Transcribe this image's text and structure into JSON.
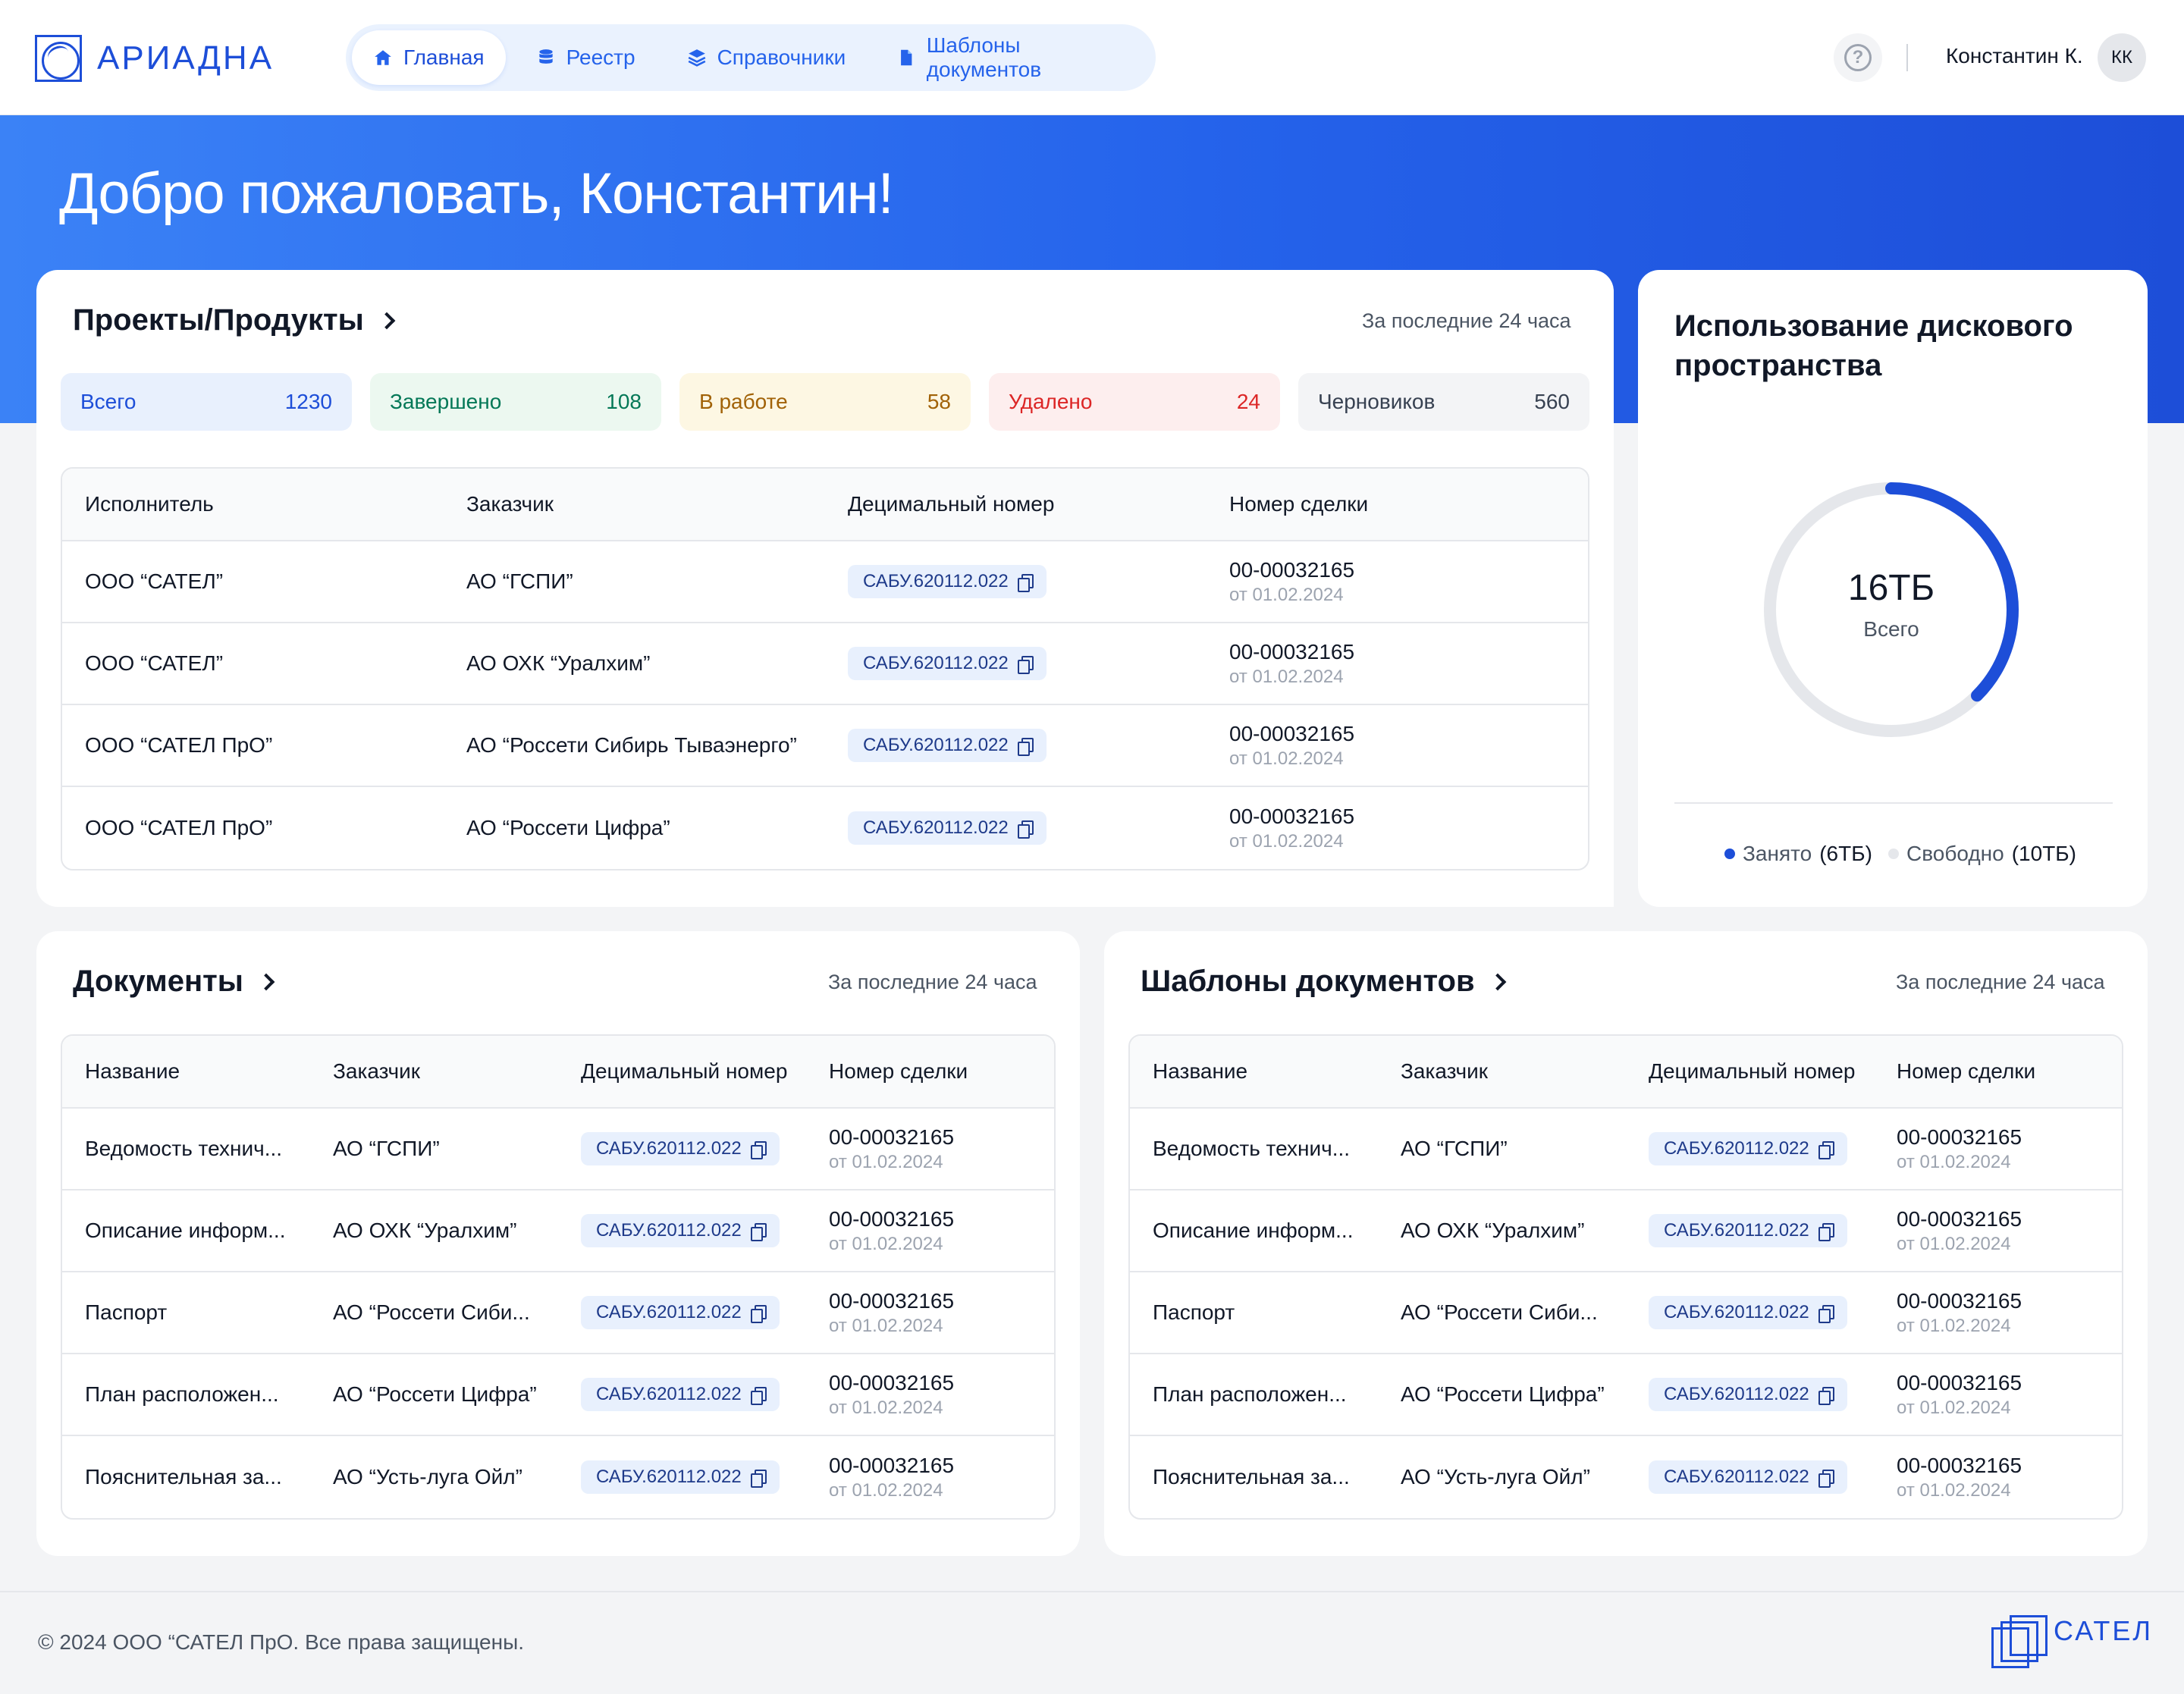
{
  "app": {
    "logo_text": "АРИАДНА"
  },
  "nav": {
    "items": [
      {
        "label": "Главная",
        "icon": "home-icon",
        "active": true
      },
      {
        "label": "Реестр",
        "icon": "database-icon",
        "active": false
      },
      {
        "label": "Справочники",
        "icon": "layers-icon",
        "active": false
      },
      {
        "label": "Шаблоны документов",
        "icon": "document-icon",
        "active": false
      }
    ]
  },
  "header": {
    "user_name": "Константин К.",
    "avatar_initials": "КК",
    "help_icon": "help-icon"
  },
  "hero": {
    "title": "Добро пожаловать, Константин!"
  },
  "projects": {
    "title": "Проекты/Продукты",
    "period": "За последние 24 часа",
    "stats": [
      {
        "label": "Всего",
        "value": "1230",
        "bg": "#e8f0fd",
        "fg": "#1d4ed8"
      },
      {
        "label": "Завершено",
        "value": "108",
        "bg": "#ecf8f0",
        "fg": "#047857"
      },
      {
        "label": "В работе",
        "value": "58",
        "bg": "#fdf7e3",
        "fg": "#a16207"
      },
      {
        "label": "Удалено",
        "value": "24",
        "bg": "#fdeeee",
        "fg": "#dc2626"
      },
      {
        "label": "Черновиков",
        "value": "560",
        "bg": "#f3f4f6",
        "fg": "#374151"
      }
    ],
    "columns": [
      "Исполнитель",
      "Заказчик",
      "Децимальный номер",
      "Номер сделки"
    ],
    "rows": [
      {
        "executor": "ООО “САТЕЛ”",
        "customer": "АО “ГСПИ”",
        "decimal": "САБУ.620112.022",
        "deal": "00-00032165",
        "deal_date": "от 01.02.2024"
      },
      {
        "executor": "ООО “САТЕЛ”",
        "customer": "АО ОХК “Уралхим”",
        "decimal": "САБУ.620112.022",
        "deal": "00-00032165",
        "deal_date": "от 01.02.2024"
      },
      {
        "executor": "ООО “САТЕЛ ПрО”",
        "customer": "АО “Россети Сибирь Тываэнерго”",
        "decimal": "САБУ.620112.022",
        "deal": "00-00032165",
        "deal_date": "от 01.02.2024"
      },
      {
        "executor": "ООО “САТЕЛ ПрО”",
        "customer": "АО “Россети Цифра”",
        "decimal": "САБУ.620112.022",
        "deal": "00-00032165",
        "deal_date": "от 01.02.2024"
      }
    ]
  },
  "disk": {
    "title": "Использование дискового пространства",
    "total_value": "16ТБ",
    "total_label": "Всего",
    "used_fraction": 0.375,
    "used_color": "#1d4ed8",
    "free_color": "#e5e7eb",
    "legend": [
      {
        "label": "Занято",
        "value": "(6ТБ)",
        "color": "#1d4ed8"
      },
      {
        "label": "Свободно",
        "value": "(10ТБ)",
        "color": "#e5e7eb"
      }
    ]
  },
  "documents": {
    "title": "Документы",
    "period": "За последние 24 часа",
    "columns": [
      "Название",
      "Заказчик",
      "Децимальный номер",
      "Номер сделки"
    ],
    "rows": [
      {
        "name": "Ведомость технич...",
        "customer": "АО “ГСПИ”",
        "decimal": "САБУ.620112.022",
        "deal": "00-00032165",
        "deal_date": "от 01.02.2024"
      },
      {
        "name": "Описание информ...",
        "customer": "АО ОХК “Уралхим”",
        "decimal": "САБУ.620112.022",
        "deal": "00-00032165",
        "deal_date": "от 01.02.2024"
      },
      {
        "name": "Паспорт",
        "customer": "АО “Россети Сиби...",
        "decimal": "САБУ.620112.022",
        "deal": "00-00032165",
        "deal_date": "от 01.02.2024"
      },
      {
        "name": "План расположен...",
        "customer": "АО “Россети Цифра”",
        "decimal": "САБУ.620112.022",
        "deal": "00-00032165",
        "deal_date": "от 01.02.2024"
      },
      {
        "name": "Пояснительная за...",
        "customer": "АО “Усть-луга Ойл”",
        "decimal": "САБУ.620112.022",
        "deal": "00-00032165",
        "deal_date": "от 01.02.2024"
      }
    ]
  },
  "templates": {
    "title": "Шаблоны документов",
    "period": "За последние 24 часа",
    "columns": [
      "Название",
      "Заказчик",
      "Децимальный номер",
      "Номер сделки"
    ],
    "rows": [
      {
        "name": "Ведомость технич...",
        "customer": "АО “ГСПИ”",
        "decimal": "САБУ.620112.022",
        "deal": "00-00032165",
        "deal_date": "от 01.02.2024"
      },
      {
        "name": "Описание информ...",
        "customer": "АО ОХК “Уралхим”",
        "decimal": "САБУ.620112.022",
        "deal": "00-00032165",
        "deal_date": "от 01.02.2024"
      },
      {
        "name": "Паспорт",
        "customer": "АО “Россети Сиби...",
        "decimal": "САБУ.620112.022",
        "deal": "00-00032165",
        "deal_date": "от 01.02.2024"
      },
      {
        "name": "План расположен...",
        "customer": "АО “Россети Цифра”",
        "decimal": "САБУ.620112.022",
        "deal": "00-00032165",
        "deal_date": "от 01.02.2024"
      },
      {
        "name": "Пояснительная за...",
        "customer": "АО “Усть-луга Ойл”",
        "decimal": "САБУ.620112.022",
        "deal": "00-00032165",
        "deal_date": "от 01.02.2024"
      }
    ]
  },
  "footer": {
    "copyright": "© 2024 ООО “САТЕЛ ПрО. Все права защищены.",
    "brand": "САТЕЛ"
  }
}
